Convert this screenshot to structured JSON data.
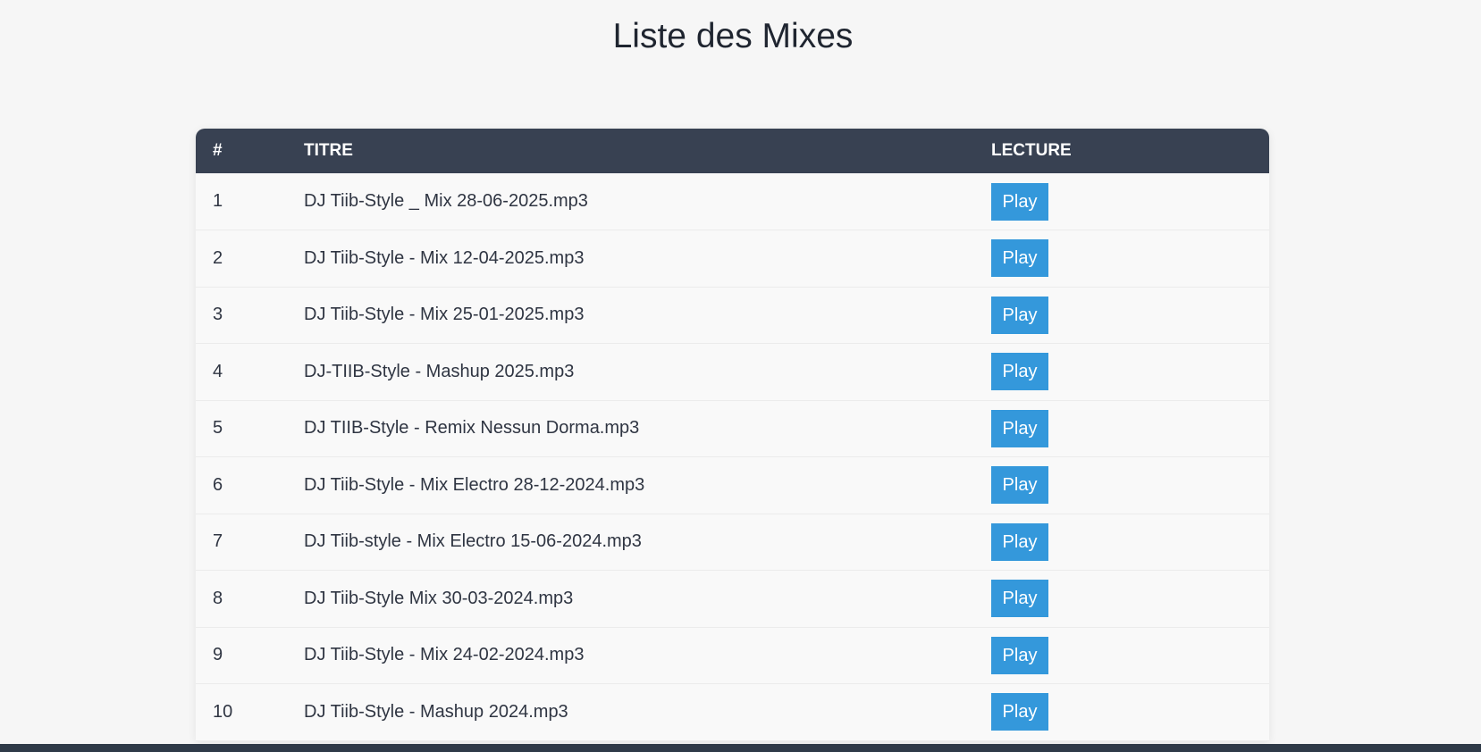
{
  "page": {
    "title": "Liste des Mixes"
  },
  "table": {
    "headers": {
      "num": "#",
      "title": "TITRE",
      "play": "LECTURE"
    },
    "rows": [
      {
        "num": "1",
        "title": "DJ Tiib-Style _ Mix 28-06-2025.mp3",
        "button": "Play"
      },
      {
        "num": "2",
        "title": "DJ Tiib-Style - Mix 12-04-2025.mp3",
        "button": "Play"
      },
      {
        "num": "3",
        "title": "DJ Tiib-Style - Mix 25-01-2025.mp3",
        "button": "Play"
      },
      {
        "num": "4",
        "title": "DJ-TIIB-Style - Mashup 2025.mp3",
        "button": "Play"
      },
      {
        "num": "5",
        "title": "DJ TIIB-Style - Remix Nessun Dorma.mp3",
        "button": "Play"
      },
      {
        "num": "6",
        "title": "DJ Tiib-Style - Mix Electro 28-12-2024.mp3",
        "button": "Play"
      },
      {
        "num": "7",
        "title": "DJ Tiib-style - Mix Electro 15-06-2024.mp3",
        "button": "Play"
      },
      {
        "num": "8",
        "title": "DJ Tiib-Style Mix 30-03-2024.mp3",
        "button": "Play"
      },
      {
        "num": "9",
        "title": "DJ Tiib-Style - Mix 24-02-2024.mp3",
        "button": "Play"
      },
      {
        "num": "10",
        "title": "DJ Tiib-Style - Mashup 2024.mp3",
        "button": "Play"
      }
    ]
  },
  "colors": {
    "background": "#f6f6f6",
    "header_bg": "#384152",
    "button_bg": "#3498db",
    "footer_bar": "#2f3a48"
  }
}
